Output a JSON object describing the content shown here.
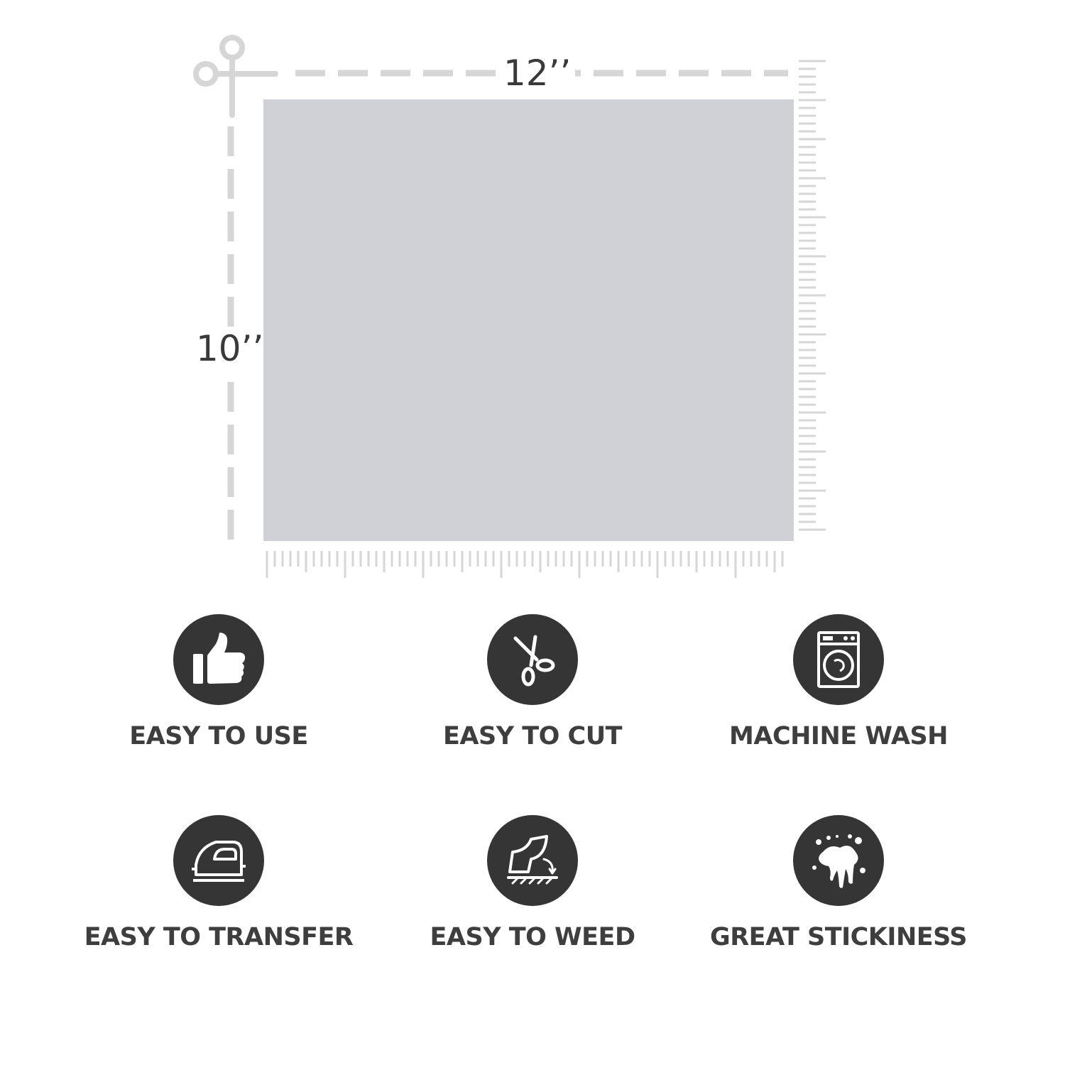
{
  "dimensions": {
    "width_label": "12’’",
    "height_label": "10’’"
  },
  "colors": {
    "sheet": "#cfd1d6",
    "guide": "#d6d6d6",
    "icon_circle": "#353535",
    "icon_glyph": "#ffffff",
    "label_text": "#3e3e3e"
  },
  "features": [
    {
      "label": "EASY TO USE",
      "icon": "thumbs-up-icon"
    },
    {
      "label": "EASY TO CUT",
      "icon": "scissors-icon"
    },
    {
      "label": "MACHINE WASH",
      "icon": "washing-machine-icon"
    },
    {
      "label": "EASY TO TRANSFER",
      "icon": "iron-icon"
    },
    {
      "label": "EASY TO WEED",
      "icon": "weeding-icon"
    },
    {
      "label": "GREAT STICKINESS",
      "icon": "splash-icon"
    }
  ]
}
